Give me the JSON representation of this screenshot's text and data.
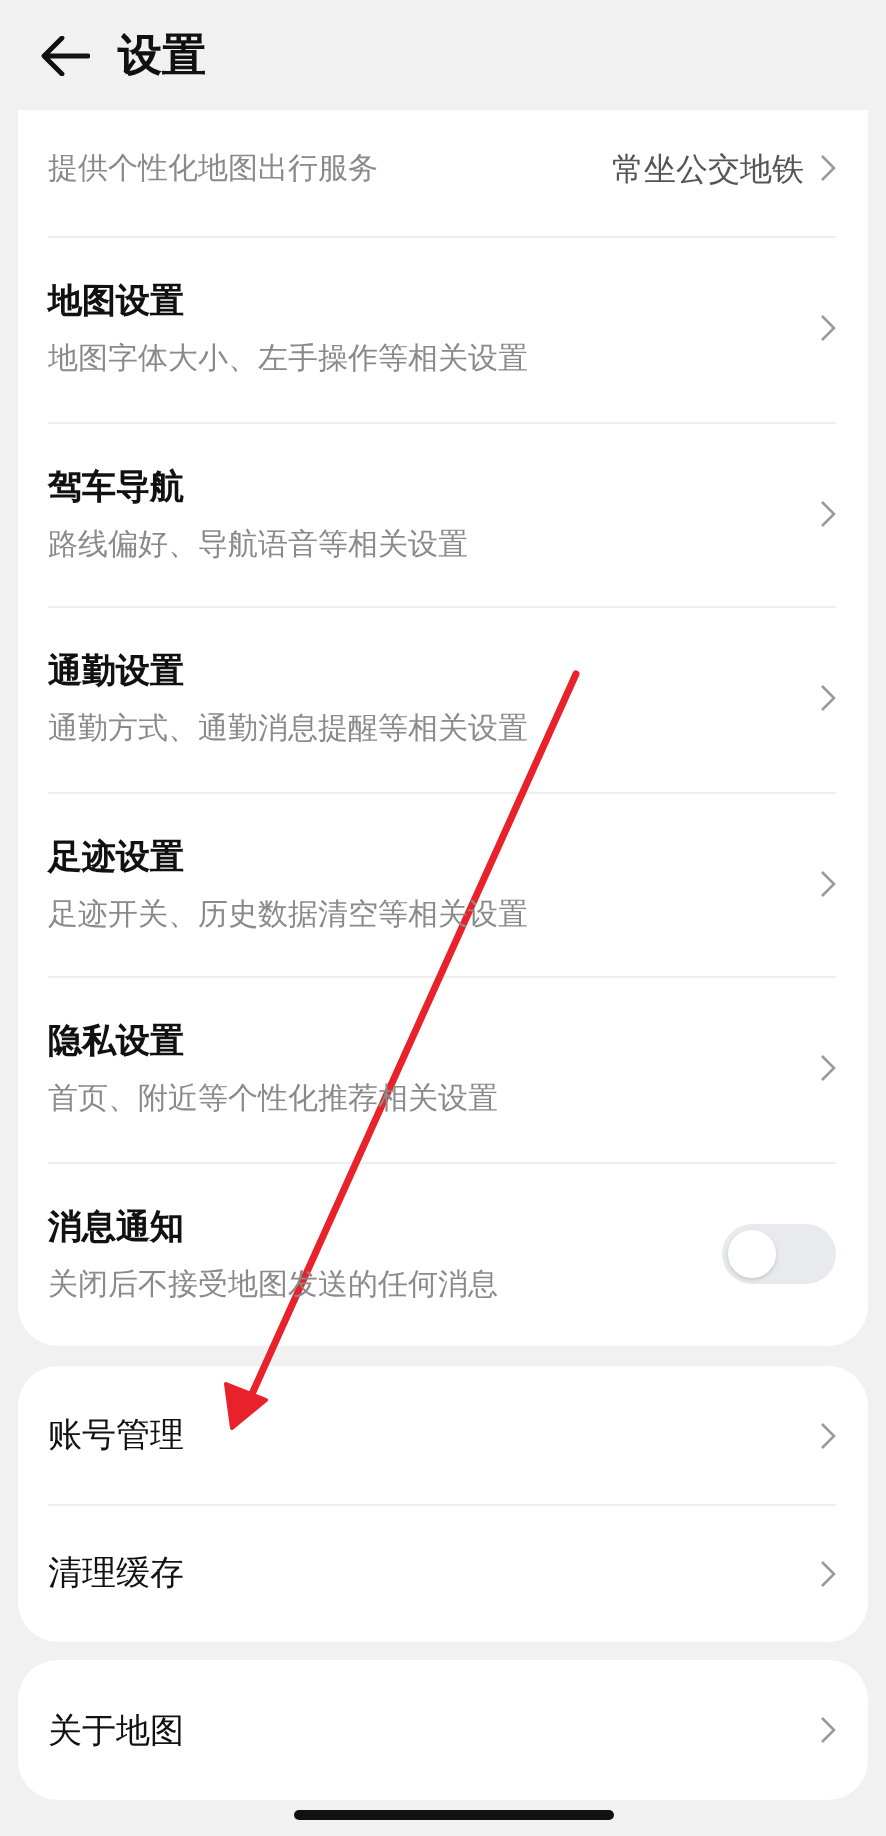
{
  "header": {
    "title": "设置"
  },
  "groups": [
    {
      "items": [
        {
          "kind": "link",
          "subtitle": "提供个性化地图出行服务",
          "value": "常坐公交地铁"
        },
        {
          "kind": "link",
          "title": "地图设置",
          "subtitle": "地图字体大小、左手操作等相关设置"
        },
        {
          "kind": "link",
          "title": "驾车导航",
          "subtitle": "路线偏好、导航语音等相关设置"
        },
        {
          "kind": "link",
          "title": "通勤设置",
          "subtitle": "通勤方式、通勤消息提醒等相关设置"
        },
        {
          "kind": "link",
          "title": "足迹设置",
          "subtitle": "足迹开关、历史数据清空等相关设置"
        },
        {
          "kind": "link",
          "title": "隐私设置",
          "subtitle": "首页、附近等个性化推荐相关设置"
        },
        {
          "kind": "toggle",
          "title": "消息通知",
          "subtitle": "关闭后不接受地图发送的任何消息",
          "on": false
        }
      ]
    },
    {
      "items": [
        {
          "kind": "link",
          "title": "账号管理"
        },
        {
          "kind": "link",
          "title": "清理缓存"
        }
      ]
    },
    {
      "items": [
        {
          "kind": "link",
          "title": "关于地图"
        }
      ]
    }
  ]
}
